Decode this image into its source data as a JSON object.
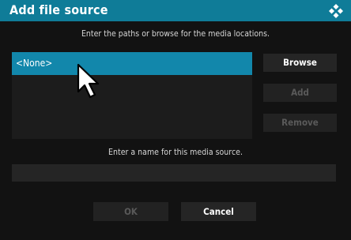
{
  "dialog": {
    "title": "Add file source",
    "logo_icon": "kodi-logo-icon"
  },
  "instructions": {
    "paths": "Enter the paths or browse for the media locations.",
    "name": "Enter a name for this media source."
  },
  "path_list": {
    "items": [
      "<None>"
    ],
    "selected_index": 0
  },
  "buttons": {
    "browse": "Browse",
    "add": "Add",
    "remove": "Remove",
    "ok": "OK",
    "cancel": "Cancel"
  },
  "name_field": {
    "value": ""
  },
  "colors": {
    "title_bar": "#0f7c98",
    "selection": "#1287ab",
    "background": "#121212",
    "button": "#252525",
    "disabled_text": "#5a5a5a"
  },
  "mouse_cursor": "arrow-cursor-icon"
}
